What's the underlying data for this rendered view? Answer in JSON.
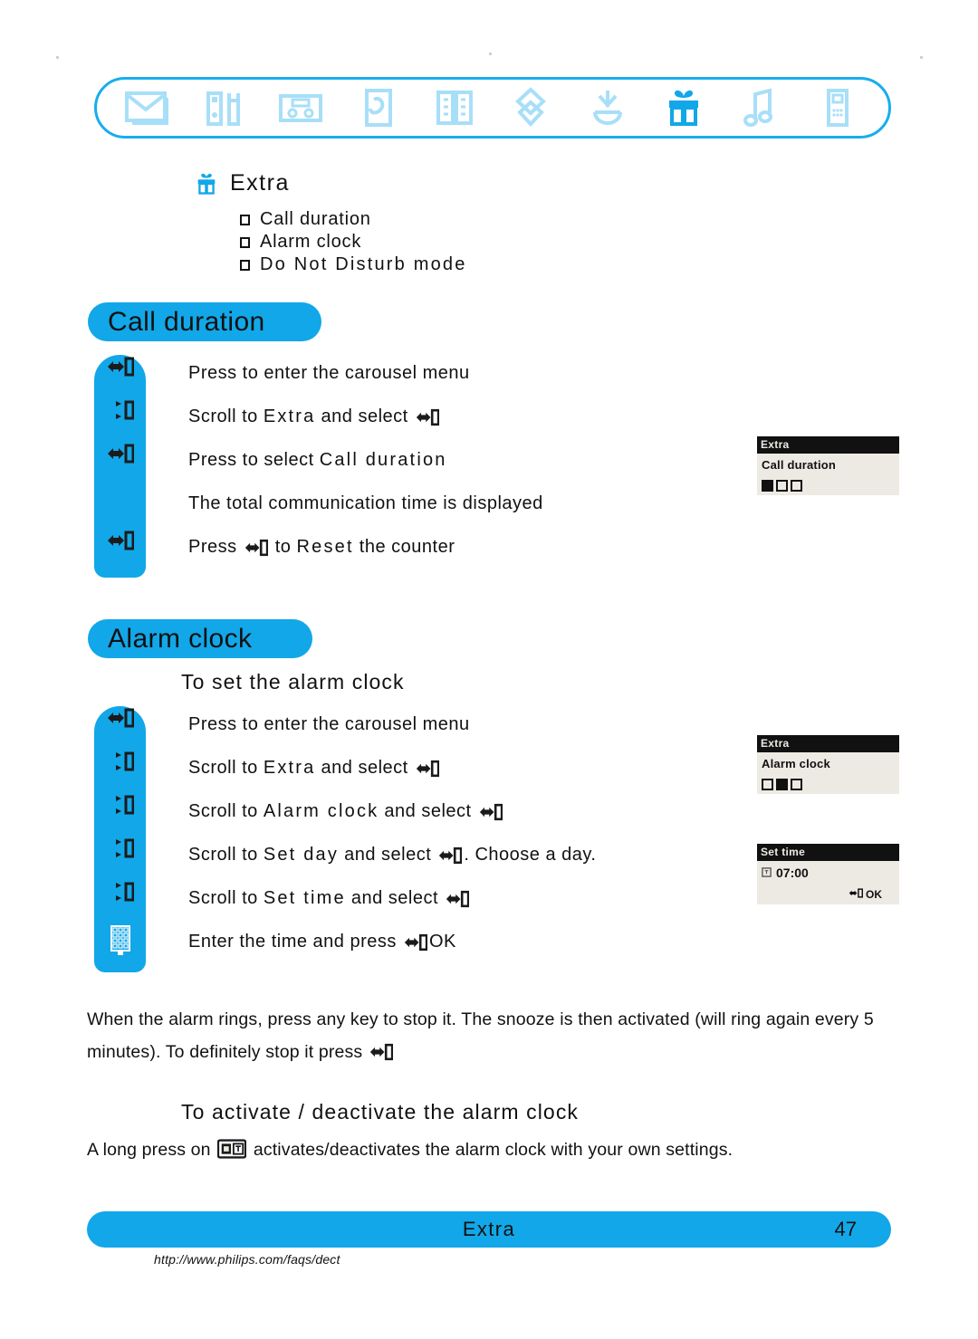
{
  "carousel": {
    "icons": [
      {
        "name": "envelope-icon",
        "label": "Messages",
        "active": false
      },
      {
        "name": "tools-icon",
        "label": "Settings",
        "active": false
      },
      {
        "name": "base-station-icon",
        "label": "Base",
        "active": false
      },
      {
        "name": "phone-list-icon",
        "label": "Calls",
        "active": false
      },
      {
        "name": "book-icon",
        "label": "Directory",
        "active": false
      },
      {
        "name": "ribbon-icon",
        "label": "Services",
        "active": false
      },
      {
        "name": "clock-alarm-icon",
        "label": "Timer",
        "active": false
      },
      {
        "name": "gift-icon",
        "label": "Extra",
        "active": true
      },
      {
        "name": "music-note-icon",
        "label": "Melodies",
        "active": false
      },
      {
        "name": "handset-icon",
        "label": "Handset",
        "active": false
      }
    ]
  },
  "extra_section": {
    "heading": "Extra",
    "heading_icon": "gift-icon",
    "items": [
      "Call duration",
      "Alarm clock",
      "Do Not Disturb mode"
    ]
  },
  "call_duration": {
    "title": "Call duration",
    "steps": [
      {
        "key": "menu-key",
        "text_parts": [
          {
            "t": "Press to enter the carousel menu",
            "style": "normal"
          }
        ]
      },
      {
        "key": "scroll-key",
        "text_parts": [
          {
            "t": "Scroll to ",
            "style": "normal"
          },
          {
            "t": "Extra",
            "style": "mono"
          },
          {
            "t": " and select ",
            "style": "normal"
          },
          {
            "t": "",
            "style": "keyglyph"
          }
        ]
      },
      {
        "key": "menu-key",
        "text_parts": [
          {
            "t": "Press to select ",
            "style": "normal"
          },
          {
            "t": "Call duration",
            "style": "mono"
          }
        ]
      },
      {
        "key": "none",
        "text_parts": [
          {
            "t": "The total communication time is displayed",
            "style": "normal"
          }
        ]
      },
      {
        "key": "menu-key",
        "text_parts": [
          {
            "t": "Press ",
            "style": "normal"
          },
          {
            "t": "",
            "style": "keyglyph"
          },
          {
            "t": " to ",
            "style": "normal"
          },
          {
            "t": "Reset",
            "style": "mono"
          },
          {
            "t": " the counter",
            "style": "normal"
          }
        ]
      }
    ],
    "lcd": {
      "title": "Extra",
      "line": "Call duration",
      "dots": [
        true,
        false,
        false
      ]
    }
  },
  "alarm_clock": {
    "title": "Alarm clock",
    "subheading_set": "To set the alarm clock",
    "steps": [
      {
        "key": "menu-key",
        "text_parts": [
          {
            "t": "Press to enter the carousel menu",
            "style": "normal"
          }
        ]
      },
      {
        "key": "scroll-key",
        "text_parts": [
          {
            "t": "Scroll to ",
            "style": "normal"
          },
          {
            "t": "Extra",
            "style": "mono"
          },
          {
            "t": " and select ",
            "style": "normal"
          },
          {
            "t": "",
            "style": "keyglyph"
          }
        ]
      },
      {
        "key": "scroll-key",
        "text_parts": [
          {
            "t": "Scroll to ",
            "style": "normal"
          },
          {
            "t": "Alarm clock",
            "style": "mono"
          },
          {
            "t": " and select ",
            "style": "normal"
          },
          {
            "t": "",
            "style": "keyglyph"
          }
        ]
      },
      {
        "key": "scroll-key",
        "text_parts": [
          {
            "t": "Scroll to ",
            "style": "normal"
          },
          {
            "t": "Set day",
            "style": "mono"
          },
          {
            "t": " and select ",
            "style": "normal"
          },
          {
            "t": "",
            "style": "keyglyph"
          },
          {
            "t": ". Choose a day.",
            "style": "normal"
          }
        ]
      },
      {
        "key": "scroll-key",
        "text_parts": [
          {
            "t": "Scroll to ",
            "style": "normal"
          },
          {
            "t": "Set time",
            "style": "mono"
          },
          {
            "t": " and select ",
            "style": "normal"
          },
          {
            "t": "",
            "style": "keyglyph"
          }
        ]
      },
      {
        "key": "keypad-key",
        "text_parts": [
          {
            "t": "Enter the time and press ",
            "style": "normal"
          },
          {
            "t": "",
            "style": "keyglyph"
          },
          {
            "t": "OK",
            "style": "normal"
          }
        ]
      }
    ],
    "lcd_alarm": {
      "title": "Extra",
      "line": "Alarm clock",
      "dots": [
        false,
        true,
        false
      ]
    },
    "lcd_settime": {
      "title": "Set time",
      "time": "07:00",
      "softkey": "OK"
    },
    "snooze_note_part1": "When the alarm rings, press any key to stop it. The snooze is then activated (will ring again every 5",
    "snooze_note_part2": "minutes). To definitely stop it press",
    "subheading_activate": "To activate / deactivate the alarm clock",
    "activate_note_part1": "A long press on",
    "activate_note_part2": "activates/deactivates the alarm clock with your own settings."
  },
  "footer": {
    "section": "Extra",
    "page": "47",
    "url": "http://www.philips.com/faqs/dect"
  },
  "colors": {
    "brand_blue": "#12A7E8",
    "icon_pale": "#A8DFF8",
    "lcd_bg": "#EDEAE4",
    "text": "#111111"
  }
}
